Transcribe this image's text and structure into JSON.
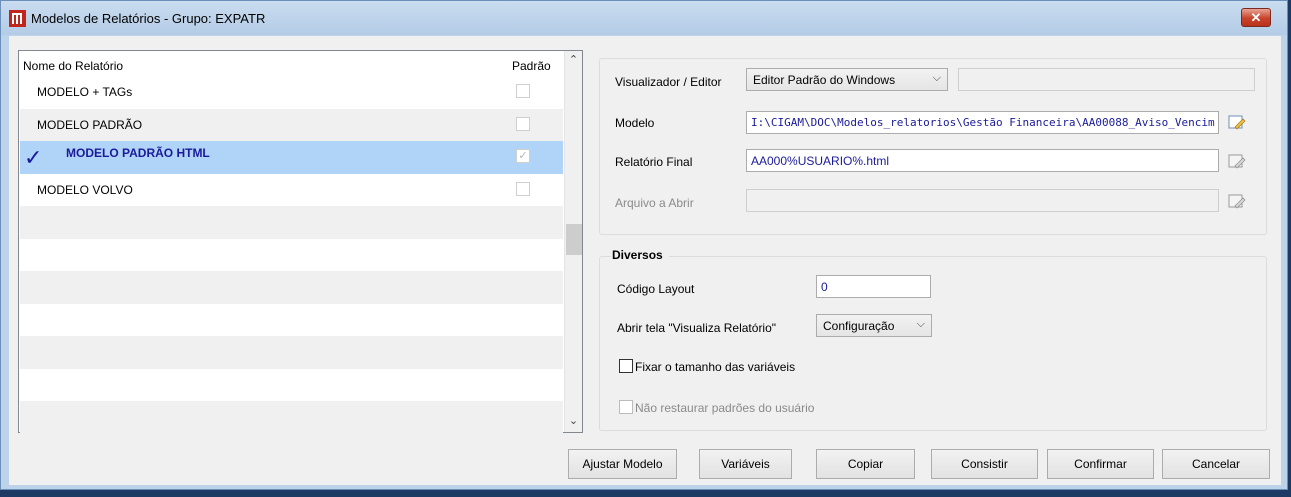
{
  "window": {
    "title": "Modelos de Relatórios - Grupo: EXPATR",
    "close_label": "✕"
  },
  "list": {
    "col_name": "Nome do Relatório",
    "col_default": "Padrão",
    "rows": [
      {
        "label": "MODELO + TAGs",
        "selected": false,
        "checked": false
      },
      {
        "label": "MODELO PADRÃO",
        "selected": false,
        "checked": false
      },
      {
        "label": "MODELO PADRÃO HTML",
        "selected": true,
        "checked": true
      },
      {
        "label": "MODELO VOLVO",
        "selected": false,
        "checked": false
      }
    ],
    "scroll_up": "⌃",
    "scroll_down": "⌄"
  },
  "editor": {
    "viewer_label": "Visualizador / Editor",
    "viewer_value": "Editor Padrão do Windows",
    "viewer_extra": "",
    "model_label": "Modelo",
    "model_value": "I:\\CIGAM\\DOC\\Modelos_relatorios\\Gestão Financeira\\AA00088_Aviso_Vencim",
    "final_label": "Relatório Final",
    "final_value": "AA000%USUARIO%.html",
    "open_label": "Arquivo a Abrir",
    "open_value": ""
  },
  "diversos": {
    "title": "Diversos",
    "layout_label": "Código Layout",
    "layout_value": "0",
    "open_screen_label": "Abrir tela \"Visualiza Relatório\"",
    "open_screen_value": "Configuração",
    "fix_size_label": "Fixar o tamanho das variáveis",
    "fix_size_checked": false,
    "no_restore_label": "Não restaurar padrões do usuário",
    "no_restore_checked": false
  },
  "buttons": {
    "adjust": "Ajustar Modelo",
    "variables": "Variáveis",
    "copy": "Copiar",
    "check": "Consistir",
    "confirm": "Confirmar",
    "cancel": "Cancelar"
  },
  "colors": {
    "selection": "#b0d4f8",
    "value_text": "#1a1a9a",
    "close_red": "#c8432c",
    "title_bar": "#bcd3ea"
  }
}
